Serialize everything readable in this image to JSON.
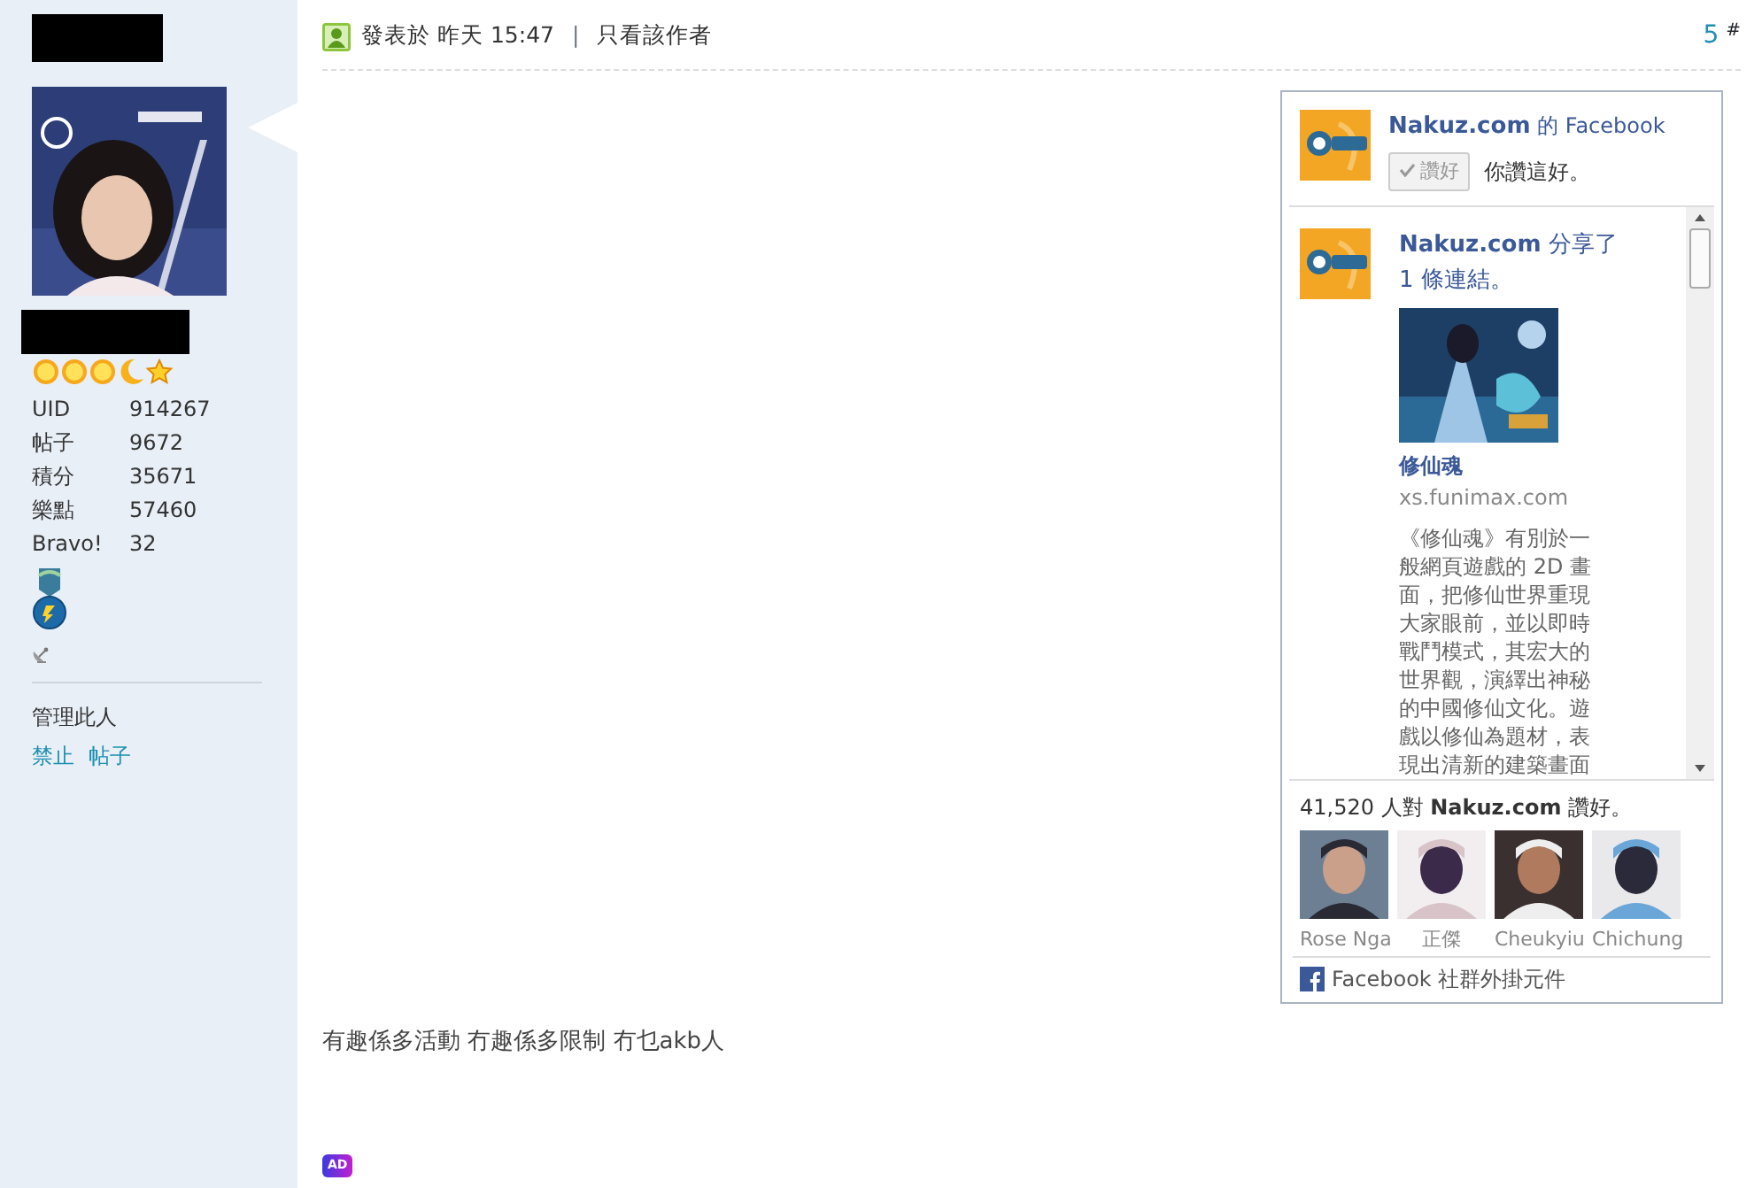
{
  "profile": {
    "level_icons": [
      {
        "kind": "sun"
      },
      {
        "kind": "sun"
      },
      {
        "kind": "sun"
      },
      {
        "kind": "moon"
      },
      {
        "kind": "star"
      }
    ],
    "stats": [
      {
        "label": "UID",
        "value": "914267"
      },
      {
        "label": "帖子",
        "value": "9672"
      },
      {
        "label": "積分",
        "value": "35671"
      },
      {
        "label": "樂點",
        "value": "57460"
      },
      {
        "label": "Bravo!",
        "value": "32"
      }
    ],
    "manage": {
      "title": "管理此人",
      "links": [
        "禁止",
        "帖子"
      ]
    }
  },
  "post": {
    "posted": "發表於 昨天 15:47",
    "separator": "|",
    "author_only": "只看該作者",
    "floor": "5",
    "floor_mark": "#",
    "body": "有趣係多活動 冇趣係多限制 冇乜akb人",
    "ad_badge": "AD"
  },
  "facebook_box": {
    "page": "Nakuz.com",
    "page_suffix": "的 Facebook",
    "like_button": "讚好",
    "liked": true,
    "you_like": "你讚這好。",
    "story": {
      "headline": "**Nakuz.com** 分享了 1 條連結。",
      "link_title": "修仙魂",
      "domain": "xs.funimax.com",
      "description": "《修仙魂》有別於一般網頁遊戲的 2D 畫面，把修仙世界重現大家眼前，並以即時戰鬥模式，其宏大的世界觀，演繹出神秘的中國修仙文化。遊戲以修仙為題材，表現出清新的建築畫面"
    },
    "likes_count": "41,520 人對 **Nakuz.com** 讚好。",
    "fans": [
      {
        "name": "Rose Nga"
      },
      {
        "name": "正傑"
      },
      {
        "name": "Cheukyiu"
      },
      {
        "name": "Chichung"
      }
    ],
    "footer": "Facebook 社群外掛元件"
  }
}
